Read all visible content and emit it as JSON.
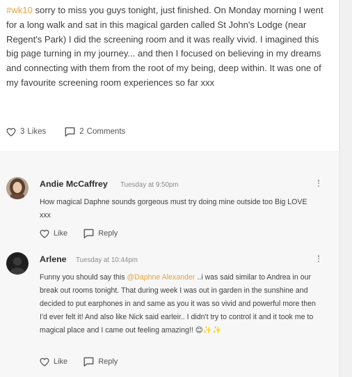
{
  "post": {
    "hashtag": "#wk10",
    "body": " sorry to miss you guys tonight, just finished. On Monday morning I went for a long walk and sat in this magical garden called St John's Lodge (near Regent's Park) I did the screening room and it was really vivid. I imagined this big page turning in my journey... and then I focused on believing in my dreams and connecting with them from the root of my being, deep within. It was one of my favourite screening room experiences so far xxx",
    "likes_count": "3",
    "likes_label": "Likes",
    "comments_count": "2",
    "comments_label": "Comments"
  },
  "comments": [
    {
      "author": "Andie McCaffrey",
      "timestamp": "Tuesday at 9:50pm",
      "text": "How magical Daphne sounds gorgeous must try doing mine outside too Big LOVE xxx",
      "like_label": "Like",
      "reply_label": "Reply"
    },
    {
      "author": "Arlene",
      "timestamp": "Tuesday at 10:44pm",
      "text_before": "Funny you should say this ",
      "mention": "@Daphne Alexander",
      "text_after": " ..i was said similar to Andrea in our break out rooms tonight. That during week I was out in garden in the sunshine and decided to put earphones in and same as you it was so vivid and powerful more then I'd ever felt it! And also like Nick said earleir.. I didn't try to control it and it took me to magical place and I came out feeling amazing!! 😊✨✨",
      "like_label": "Like",
      "reply_label": "Reply"
    }
  ],
  "colors": {
    "accent": "#e8a33c",
    "card_bg": "#ffffff",
    "comments_bg": "#f7f7f7"
  },
  "icons": [
    "heart-icon",
    "comment-bubble-icon",
    "more-options-icon"
  ]
}
